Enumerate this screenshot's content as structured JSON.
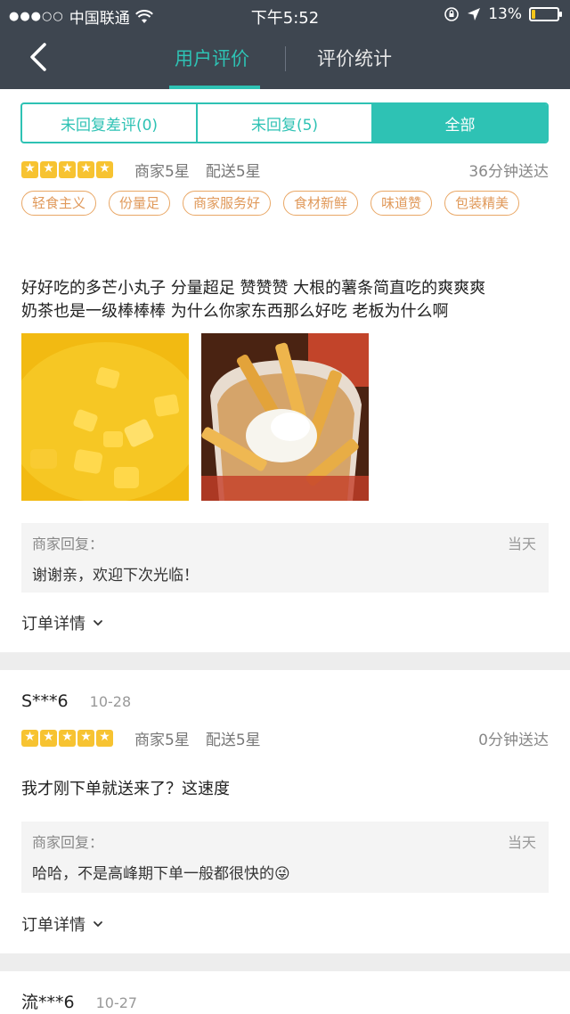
{
  "status_bar": {
    "carrier": "中国联通",
    "time": "下午5:52",
    "battery_percent": "13%",
    "battery_level": 0.13
  },
  "header": {
    "tabs": [
      {
        "label": "用户评价",
        "active": true
      },
      {
        "label": "评价统计",
        "active": false
      }
    ]
  },
  "filter": {
    "options": [
      {
        "label": "未回复差评(0)",
        "active": false
      },
      {
        "label": "未回复(5)",
        "active": false
      },
      {
        "label": "全部",
        "active": true
      }
    ]
  },
  "reviews": [
    {
      "user": "",
      "date": "",
      "stars": 5,
      "merchant_rating": "商家5星",
      "delivery_rating": "配送5星",
      "delivery_time": "36分钟送达",
      "tags": [
        "轻食主义",
        "份量足",
        "商家服务好",
        "食材新鲜",
        "味道赞",
        "包装精美"
      ],
      "text_lines": [
        "好好吃的多芒小丸子 分量超足 赞赞赞 大根的薯条简直吃的爽爽爽",
        "奶茶也是一级棒棒棒 为什么你家东西那么好吃 老板为什么啊"
      ],
      "reply": {
        "label": "商家回复：",
        "date": "当天",
        "text": "谢谢亲，欢迎下次光临！"
      },
      "order_link": "订单详情"
    },
    {
      "user": "S***6",
      "date": "10-28",
      "stars": 5,
      "merchant_rating": "商家5星",
      "delivery_rating": "配送5星",
      "delivery_time": "0分钟送达",
      "text_lines": [
        "我才刚下单就送来了？这速度"
      ],
      "reply": {
        "label": "商家回复：",
        "date": "当天",
        "text": "哈哈，不是高峰期下单一般都很快的😜"
      },
      "order_link": "订单详情"
    },
    {
      "user": "流***6",
      "date": "10-27"
    }
  ],
  "colors": {
    "accent": "#2ec2b4",
    "header_bg": "#3e4650",
    "star": "#f7c331",
    "tag": "#e9a765"
  }
}
